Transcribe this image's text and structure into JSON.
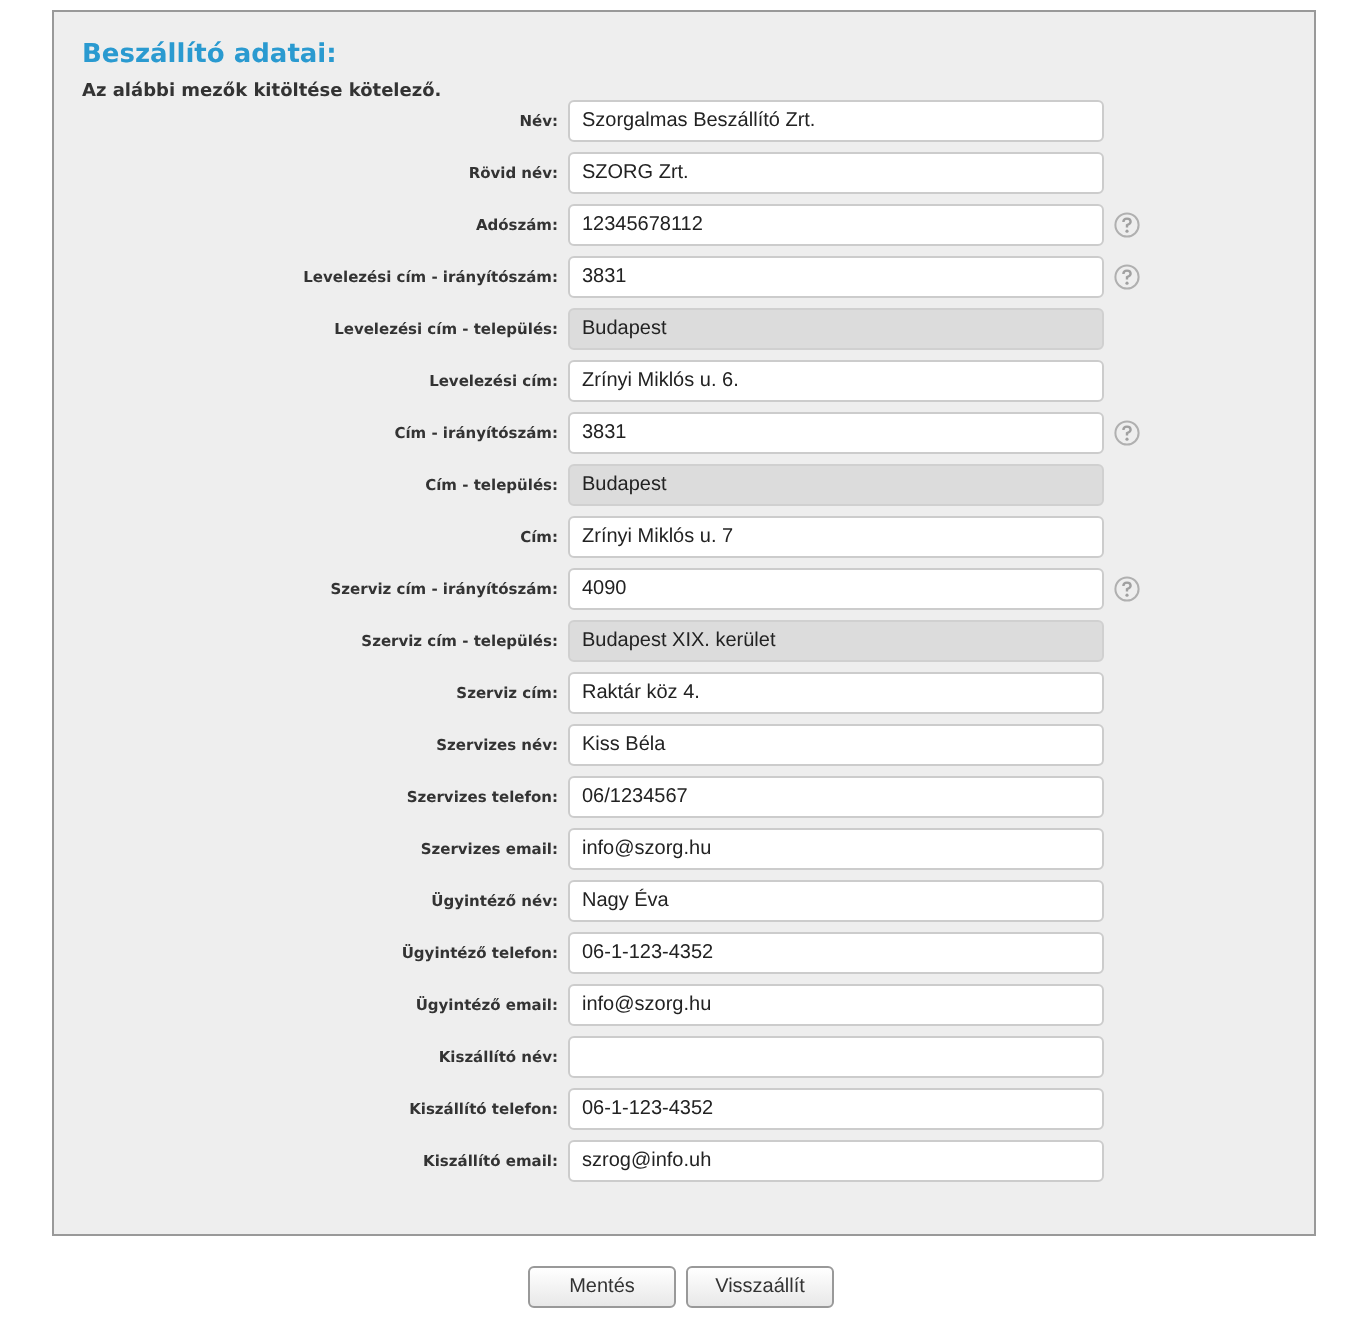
{
  "title": "Beszállító adatai:",
  "note": "Az alábbi mezők kitöltése kötelező.",
  "fields": [
    {
      "label": "Név:",
      "value": "Szorgalmas Beszállító Zrt.",
      "disabled": false,
      "help": false
    },
    {
      "label": "Rövid név:",
      "value": "SZORG Zrt.",
      "disabled": false,
      "help": false
    },
    {
      "label": "Adószám:",
      "value": "12345678112",
      "disabled": false,
      "help": true
    },
    {
      "label": "Levelezési cím - irányítószám:",
      "value": "3831",
      "disabled": false,
      "help": true
    },
    {
      "label": "Levelezési cím - település:",
      "value": "Budapest",
      "disabled": true,
      "help": false
    },
    {
      "label": "Levelezési cím:",
      "value": "Zrínyi Miklós u. 6.",
      "disabled": false,
      "help": false
    },
    {
      "label": "Cím - irányítószám:",
      "value": "3831",
      "disabled": false,
      "help": true
    },
    {
      "label": "Cím - település:",
      "value": "Budapest",
      "disabled": true,
      "help": false
    },
    {
      "label": "Cím:",
      "value": "Zrínyi Miklós u. 7",
      "disabled": false,
      "help": false
    },
    {
      "label": "Szerviz cím - irányítószám:",
      "value": "4090",
      "disabled": false,
      "help": true
    },
    {
      "label": "Szerviz cím - település:",
      "value": "Budapest XIX. kerület",
      "disabled": true,
      "help": false
    },
    {
      "label": "Szerviz cím:",
      "value": "Raktár köz 4.",
      "disabled": false,
      "help": false
    },
    {
      "label": "Szervizes név:",
      "value": "Kiss Béla",
      "disabled": false,
      "help": false
    },
    {
      "label": "Szervizes telefon:",
      "value": "06/1234567",
      "disabled": false,
      "help": false
    },
    {
      "label": "Szervizes email:",
      "value": "info@szorg.hu",
      "disabled": false,
      "help": false
    },
    {
      "label": "Ügyintéző név:",
      "value": "Nagy Éva",
      "disabled": false,
      "help": false
    },
    {
      "label": "Ügyintéző telefon:",
      "value": "06-1-123-4352",
      "disabled": false,
      "help": false
    },
    {
      "label": "Ügyintéző email:",
      "value": "info@szorg.hu",
      "disabled": false,
      "help": false
    },
    {
      "label": "Kiszállító név:",
      "disabled": false,
      "help": false
    },
    {
      "label": "Kiszállító telefon:",
      "value": "06-1-123-4352",
      "disabled": false,
      "help": false
    },
    {
      "label": "Kiszállító email:",
      "value": "szrog@info.uh",
      "disabled": false,
      "help": false
    }
  ],
  "buttons": [
    "Mentés",
    "Visszaállít"
  ]
}
